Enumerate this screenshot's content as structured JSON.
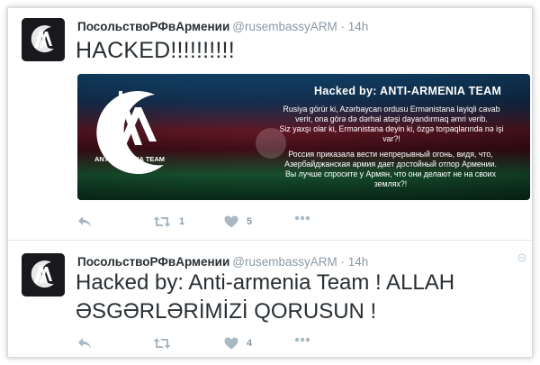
{
  "tweets": [
    {
      "name": "ПосольствоРФвАрмении",
      "handle": "@rusembassyARM",
      "separator": "·",
      "time": "14h",
      "text": "HACKED!!!!!!!!!!",
      "media": {
        "title": "Hacked by: ANTI-ARMENIA TEAM",
        "logo_text": "ANTI-ARMENIA TEAM",
        "azeri_lines": [
          "Rusiya görür ki, Azərbaycan ordusu Ermənistana layiqli cavab",
          "verir, ona görə də dərhal atəşi dayandırmaq əmri verib.",
          "Siz yaxşı olar ki, Ermənistana deyin ki, özgə torpaqlarında nə işi",
          "var?!"
        ],
        "russian_lines": [
          "Россия приказала вести непрерывный огонь, видя, что,",
          "Азербайджанская армия дает достойный отпор Армении.",
          "Вы лучше спросите у Армян, что они делают не на своих",
          "землях?!"
        ]
      },
      "actions": {
        "reply_count": "",
        "retweet_count": "1",
        "like_count": "5"
      }
    },
    {
      "name": "ПосольствоРФвАрмении",
      "handle": "@rusembassyARM",
      "separator": "·",
      "time": "14h",
      "text": "Hacked by: Anti-armenia Team !  ALLAH ƏSGƏRLƏRİMİZİ QORUSUN !",
      "actions": {
        "reply_count": "",
        "retweet_count": "",
        "like_count": "4"
      }
    }
  ],
  "icons": {
    "reply": "reply-icon",
    "retweet": "retweet-icon",
    "like": "heart-icon",
    "more": "more-dots-icon",
    "caret": "chevron-down-icon"
  },
  "colors": {
    "action_gray": "#aab8c2",
    "meta_gray": "#8899a6",
    "text": "#292f33"
  }
}
